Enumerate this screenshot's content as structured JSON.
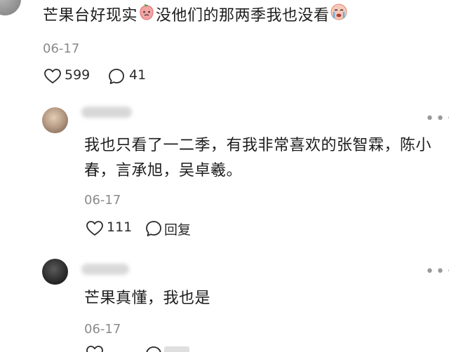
{
  "top_comment": {
    "text_part1": "芒果台好现实",
    "emoji1": "peach-face-icon",
    "text_part2": "没他们的那两季我也没看",
    "emoji2": "crying-face-icon",
    "date": "06-17",
    "likes": "599",
    "replies": "41"
  },
  "replies": [
    {
      "text": "我也只看了一二季，有我非常喜欢的张智霖，陈小春，言承旭，吴卓羲。",
      "date": "06-17",
      "likes": "111",
      "reply_label": "回复"
    },
    {
      "text": "芒果真懂，我也是",
      "date": "06-17"
    }
  ],
  "colors": {
    "text": "#1c1c1c",
    "meta": "#8a8a8a",
    "icon": "#2a2a2a"
  }
}
